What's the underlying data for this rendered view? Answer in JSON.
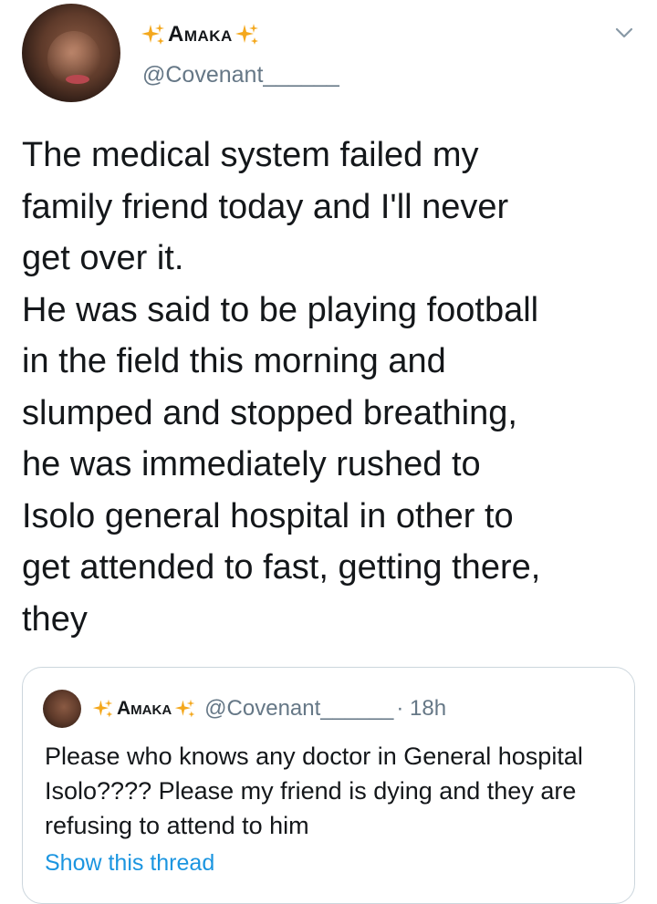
{
  "author": {
    "name": "Amaka",
    "handle": "@Covenant______",
    "sparkle_color": "#f4a81d"
  },
  "tweet": {
    "text": "The medical system failed my\nfamily friend today and I'll never\nget over it.\nHe was said to be playing football\nin the field this morning and\nslumped and stopped breathing,\nhe was immediately rushed to\nIsolo general hospital in other to\nget attended to fast, getting there,\nthey"
  },
  "quoted_tweet": {
    "name": "Amaka",
    "handle": "@Covenant______",
    "time": "· 18h",
    "text": "Please who knows any doctor in General hospital Isolo???? Please my friend is dying and they are refusing to attend to him",
    "show_thread_label": "Show this thread"
  },
  "icons": {
    "menu": "chevron-down-icon",
    "sparkle": "sparkles-emoji-icon"
  },
  "colors": {
    "text_primary": "#14171a",
    "text_secondary": "#657786",
    "link": "#1b95e0",
    "border": "#ccd6dd"
  }
}
